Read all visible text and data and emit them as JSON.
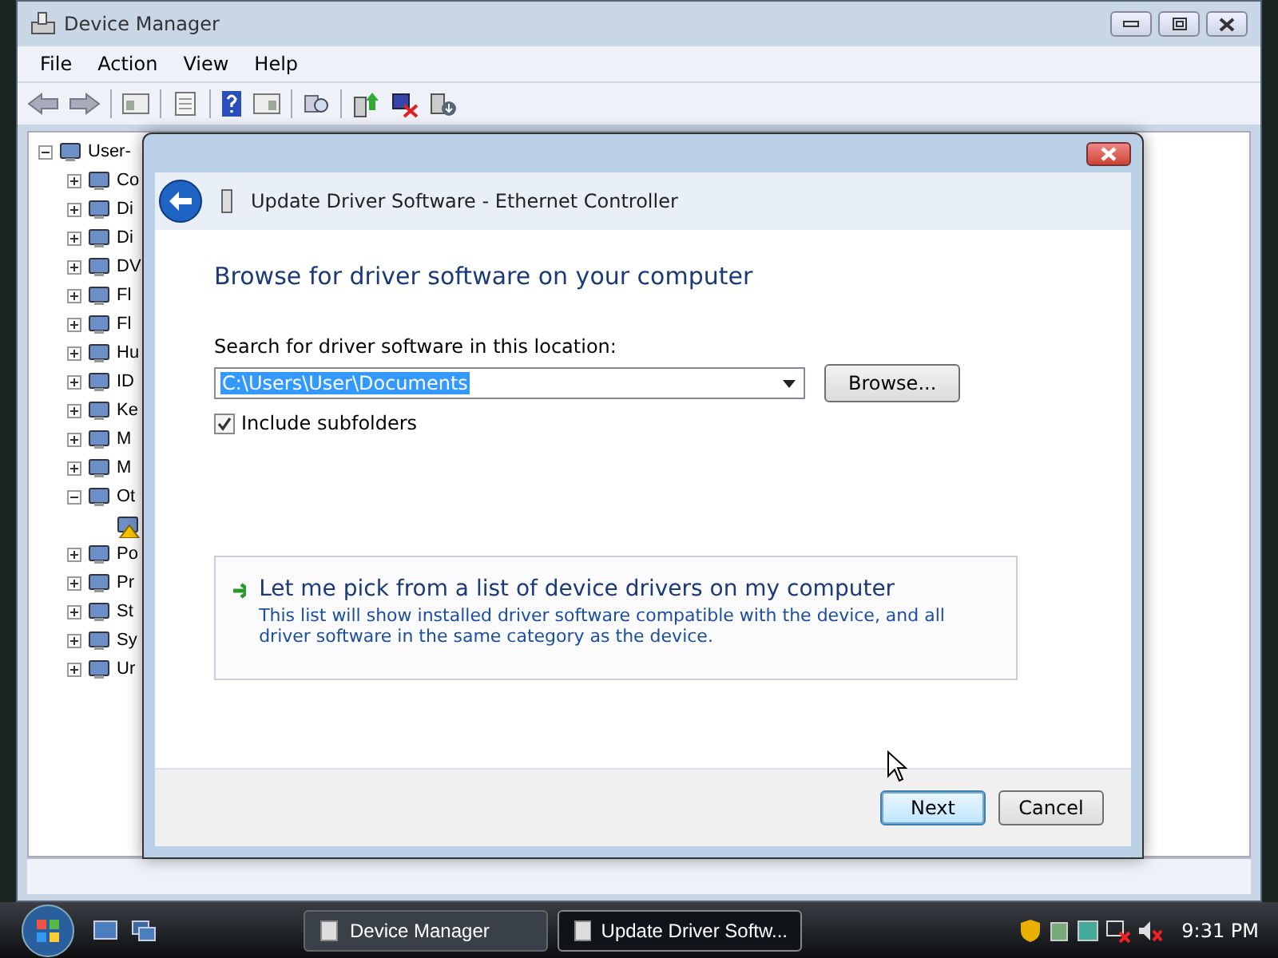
{
  "window": {
    "title": "Device Manager"
  },
  "menu": [
    "File",
    "Action",
    "View",
    "Help"
  ],
  "tree": [
    {
      "label": "User-",
      "expanded": true,
      "children": [
        {
          "label": "Co",
          "expanded": false
        },
        {
          "label": "Di",
          "expanded": false
        },
        {
          "label": "Di",
          "expanded": false
        },
        {
          "label": "DV",
          "expanded": false
        },
        {
          "label": "Fl",
          "expanded": false
        },
        {
          "label": "Fl",
          "expanded": false
        },
        {
          "label": "Hu",
          "expanded": false
        },
        {
          "label": "ID",
          "expanded": false
        },
        {
          "label": "Ke",
          "expanded": false
        },
        {
          "label": "M",
          "expanded": false
        },
        {
          "label": "M",
          "expanded": false
        },
        {
          "label": "Ot",
          "expanded": true,
          "children": [
            {
              "warning": true
            }
          ]
        },
        {
          "label": "Po",
          "expanded": false
        },
        {
          "label": "Pr",
          "expanded": false
        },
        {
          "label": "St",
          "expanded": false
        },
        {
          "label": "Sy",
          "expanded": false
        },
        {
          "label": "Ur",
          "expanded": false
        }
      ]
    }
  ],
  "dialog": {
    "title": "Update Driver Software - Ethernet Controller",
    "heading": "Browse for driver software on your computer",
    "search_label": "Search for driver software in this location:",
    "path": {
      "value": "C:\\Users\\User\\Documents",
      "selected": true
    },
    "browse_button": "Browse...",
    "include_subfolders": {
      "label": "Include subfolders",
      "checked": true
    },
    "option": {
      "title": "Let me pick from a list of device drivers on my computer",
      "description": "This list will show installed driver software compatible with the device, and all driver software in the same category as the device."
    },
    "buttons": [
      {
        "label": "Next",
        "default": true
      },
      {
        "label": "Cancel",
        "default": false
      }
    ]
  },
  "taskbar": {
    "tasks": [
      {
        "label": "Device Manager",
        "selected": false
      },
      {
        "label": "Update Driver Softw...",
        "selected": true
      }
    ],
    "clock": "9:31 PM"
  }
}
